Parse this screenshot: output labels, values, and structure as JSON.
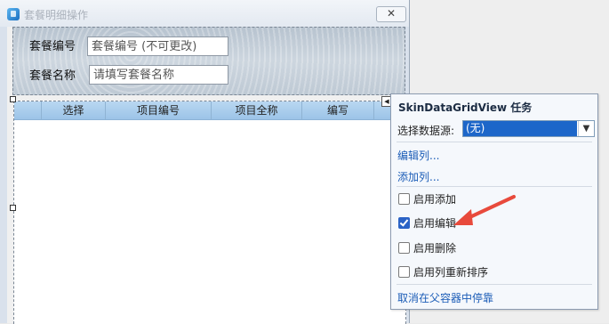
{
  "window": {
    "title": "套餐明细操作",
    "close_glyph": "✕"
  },
  "form": {
    "package_no_label": "套餐编号",
    "package_no_value": "套餐编号 (不可更改)",
    "package_name_label": "套餐名称",
    "package_name_placeholder": "请填写套餐名称"
  },
  "grid": {
    "columns": [
      "选择",
      "项目编号",
      "项目全称",
      "编写"
    ]
  },
  "task_panel": {
    "title": "SkinDataGridView 任务",
    "datasource_label": "选择数据源:",
    "datasource_value": "(无)",
    "edit_columns": "编辑列...",
    "add_column": "添加列...",
    "options": [
      {
        "label": "启用添加",
        "checked": false
      },
      {
        "label": "启用编辑",
        "checked": true
      },
      {
        "label": "启用删除",
        "checked": false
      },
      {
        "label": "启用列重新排序",
        "checked": false
      }
    ],
    "dock": "取消在父容器中停靠"
  },
  "colors": {
    "accent": "#1c66c9",
    "link": "#1c5db7",
    "annotation_arrow": "#e84a3c"
  },
  "icons": {
    "app": "app-icon",
    "close": "close-icon",
    "dropdown": "chevron-down-icon",
    "smart_tag": "smart-tag-icon"
  }
}
